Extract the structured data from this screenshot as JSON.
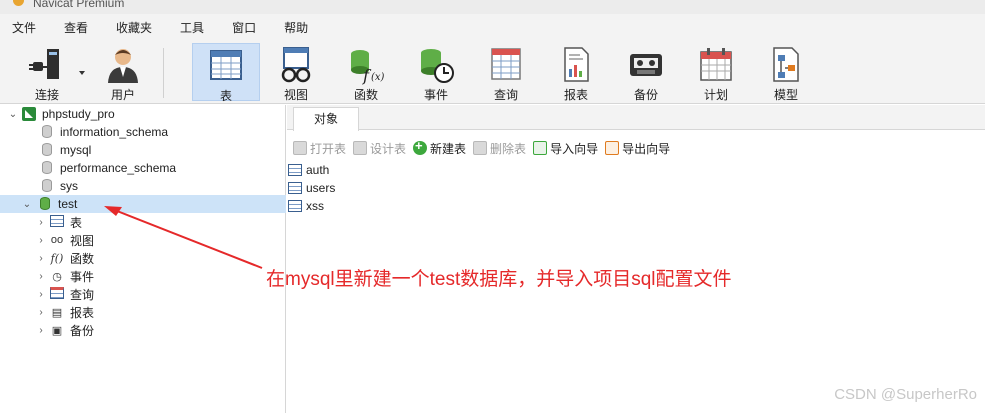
{
  "window": {
    "title": "Navicat Premium"
  },
  "menubar": [
    "文件",
    "查看",
    "收藏夹",
    "工具",
    "窗口",
    "帮助"
  ],
  "toolbar": {
    "connect": "连接",
    "user": "用户",
    "table": "表",
    "view": "视图",
    "function": "函数",
    "event": "事件",
    "query": "查询",
    "report": "报表",
    "backup": "备份",
    "schedule": "计划",
    "model": "模型"
  },
  "navigator": {
    "connection": "phpstudy_pro",
    "databases": [
      "information_schema",
      "mysql",
      "performance_schema",
      "sys"
    ],
    "selected_db": "test",
    "children": [
      "表",
      "视图",
      "函数",
      "事件",
      "查询",
      "报表",
      "备份"
    ]
  },
  "tabs": {
    "objects": "对象"
  },
  "object_toolbar": {
    "open_table": "打开表",
    "design_table": "设计表",
    "new_table": "新建表",
    "delete_table": "删除表",
    "import_wizard": "导入向导",
    "export_wizard": "导出向导"
  },
  "objects": [
    "auth",
    "users",
    "xss"
  ],
  "annotation": "在mysql里新建一个test数据库，并导入项目sql配置文件",
  "watermark": "CSDN @SuperherRo",
  "colors": {
    "selection": "#cde3f8",
    "annotation": "#e5292a",
    "active_tool": "#cfe1f7"
  }
}
